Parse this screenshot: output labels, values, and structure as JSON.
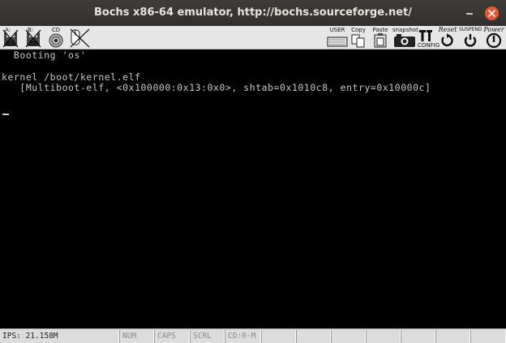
{
  "window": {
    "title": "Bochs x86-64 emulator, http://bochs.sourceforge.net/"
  },
  "toolbar": {
    "floppy_a_label": "A:",
    "floppy_b_label": "B:",
    "cdrom_label": "CD",
    "user_label": "USER",
    "copy_label": "Copy",
    "paste_label": "Paste",
    "snapshot_label": "snapshot",
    "config_label": "CONFIG",
    "reset_label": "Reset",
    "suspend_label": "SUSPEND",
    "power_label": "Power",
    "icons": [
      "floppy-a-icon",
      "floppy-b-icon",
      "cdrom-icon",
      "mouse-icon",
      "keyboard-icon",
      "copy-icon",
      "paste-icon",
      "snapshot-icon",
      "config-icon",
      "reset-icon",
      "suspend-icon",
      "power-icon"
    ]
  },
  "screen": {
    "lines": [
      "  Booting 'os'",
      "kernel /boot/kernel.elf",
      "   [Multiboot-elf, <0x100000:0x13:0x0>, shtab=0x1010c8, entry=0x10000c]"
    ],
    "text_color": "#c8c8c8",
    "background": "#000000"
  },
  "statusbar": {
    "ips": "IPS: 21.158M",
    "num": "NUM",
    "caps": "CAPS",
    "scrl": "SCRL",
    "cd": "CD:0-M"
  }
}
